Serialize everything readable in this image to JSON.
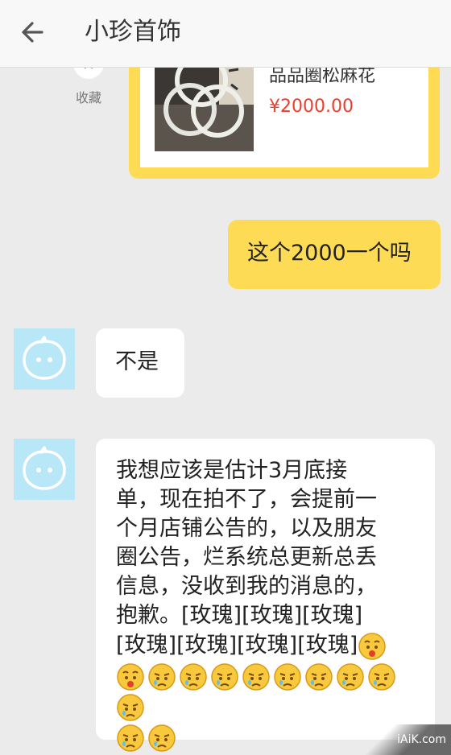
{
  "header": {
    "title": "小珍首饰",
    "back_icon": "back-arrow-icon"
  },
  "product": {
    "fav_label": "收藏",
    "name": "品品圈松麻花",
    "price": "¥2000.00"
  },
  "messages": [
    {
      "from": "me",
      "text": "这个2000一个吗"
    },
    {
      "from": "them",
      "text": "不是"
    },
    {
      "from": "them",
      "lines": [
        "我想应该是估计3月底接",
        "单，现在拍不了，会提前一",
        "个月店铺公告的，以及朋友",
        "圈公告，烂系统总更新总丢",
        "信息，没收到我的消息的，",
        "抱歉。[玫瑰][玫瑰][玫瑰]",
        "[玫瑰][玫瑰][玫瑰][玫瑰]"
      ]
    }
  ],
  "watermark": "iAiK.com",
  "colors": {
    "my_bubble": "#fddb54",
    "avatar_bg": "#b8e7f7",
    "price": "#e8402f"
  }
}
